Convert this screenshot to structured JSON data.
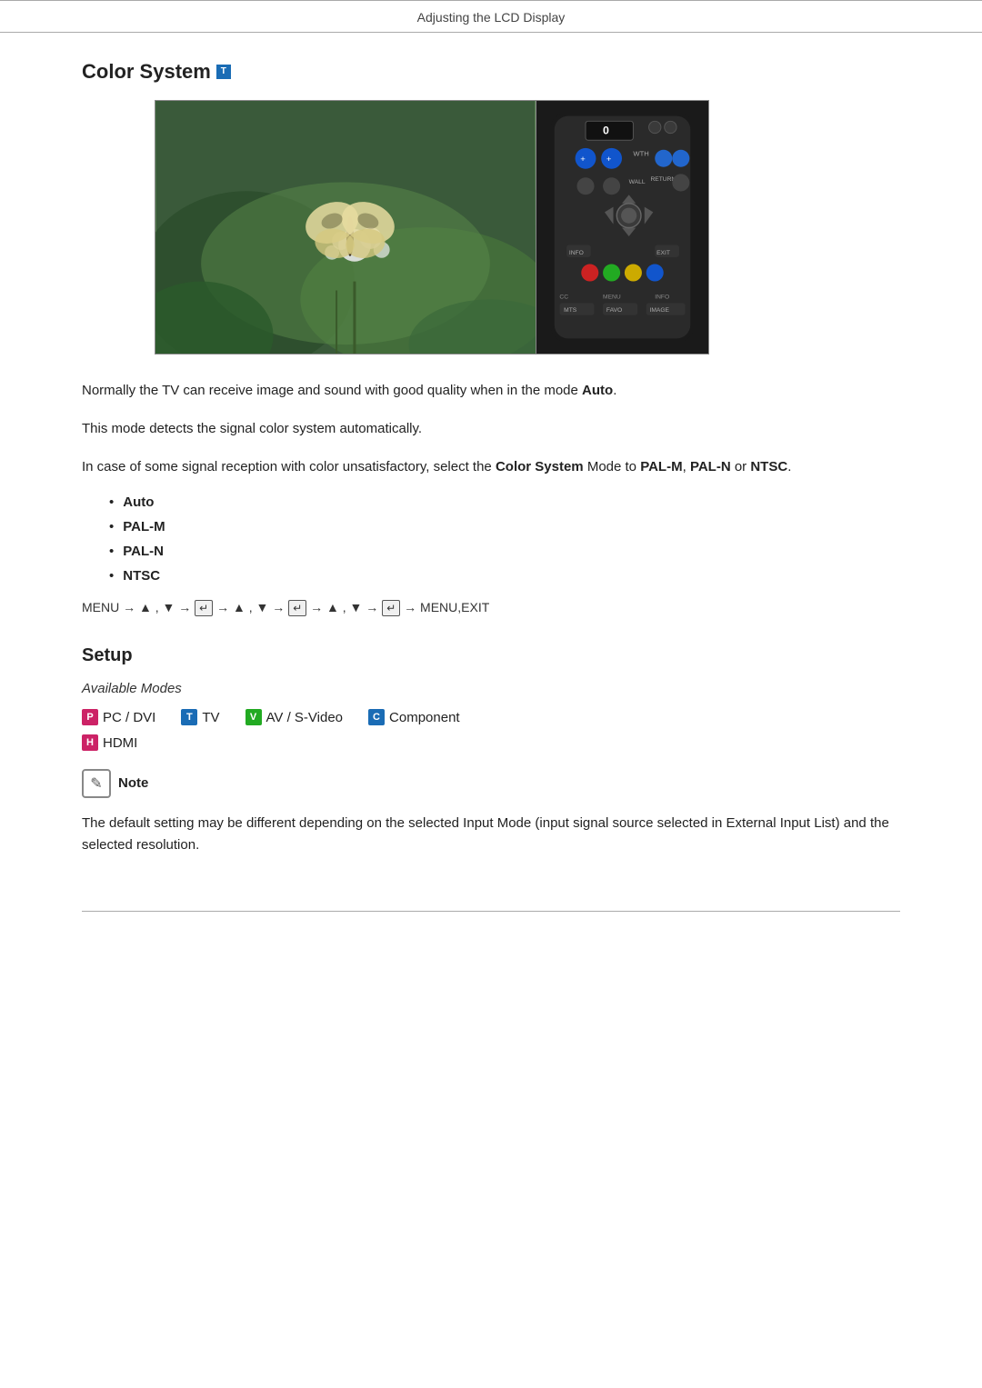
{
  "header": {
    "title": "Adjusting the LCD Display"
  },
  "color_system": {
    "title": "Color System",
    "title_icon": "T",
    "para1": "Normally the TV can receive image and sound with good quality when in the mode ",
    "para1_bold": "Auto",
    "para1_end": ".",
    "para2": "This mode detects the signal color system automatically.",
    "para3_start": "In case of some signal reception with color unsatisfactory, select the ",
    "para3_bold1": "Color System",
    "para3_mid": " Mode to ",
    "para3_bold2": "PAL-M",
    "para3_comma": ", ",
    "para3_bold3": "PAL-N",
    "para3_or": " or ",
    "para3_bold4": "NTSC",
    "para3_end": ".",
    "bullets": [
      {
        "label": "Auto"
      },
      {
        "label": "PAL-M"
      },
      {
        "label": "PAL-N"
      },
      {
        "label": "NTSC"
      }
    ],
    "menu_nav": "MENU → ▲ , ▼ → [↵] → ▲ , ▼ → [↵] → ▲ , ▼ → [↵] → MENU,EXIT"
  },
  "setup": {
    "title": "Setup",
    "available_modes_label": "Available Modes",
    "modes": [
      {
        "icon": "P",
        "icon_class": "icon-pc",
        "label": "PC / DVI"
      },
      {
        "icon": "T",
        "icon_class": "icon-tv",
        "label": "TV"
      },
      {
        "icon": "V",
        "icon_class": "icon-av",
        "label": "AV / S-Video"
      },
      {
        "icon": "C",
        "icon_class": "icon-comp",
        "label": "Component"
      }
    ],
    "modes_row2": [
      {
        "icon": "H",
        "icon_class": "icon-hdmi",
        "label": "HDMI"
      }
    ],
    "note_icon": "✎",
    "note_label": "Note",
    "note_text": "The default setting may be different depending on the selected Input Mode (input signal source selected in External Input List) and the selected resolution."
  }
}
